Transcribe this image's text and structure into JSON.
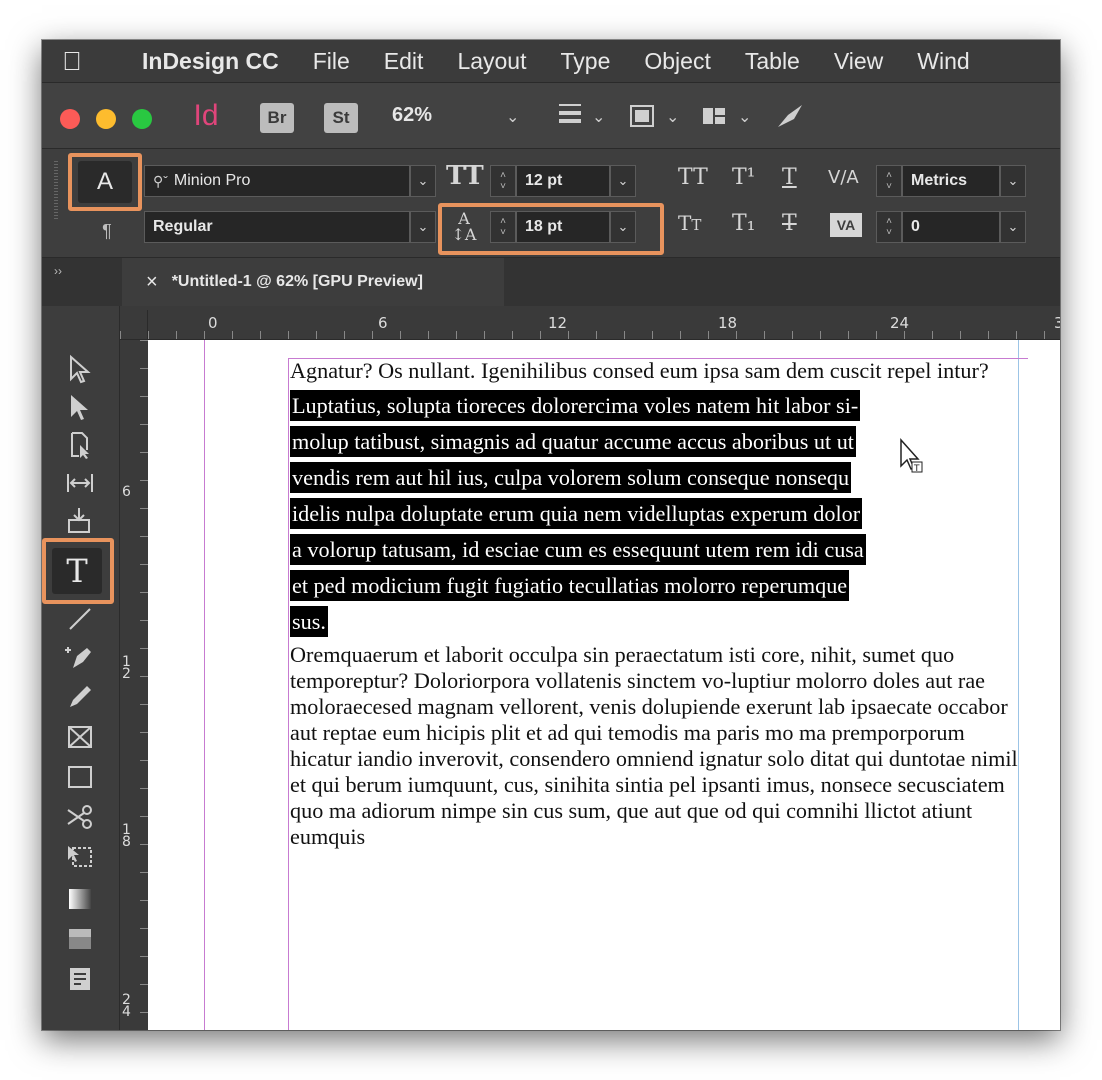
{
  "menubar": {
    "app_name": "InDesign CC",
    "items": [
      "File",
      "Edit",
      "Layout",
      "Type",
      "Object",
      "Table",
      "View",
      "Wind"
    ]
  },
  "appbar": {
    "id_badge": "Id",
    "br_badge": "Br",
    "st_badge": "St",
    "zoom": "62%"
  },
  "control_panel": {
    "font_family": "Minion Pro",
    "font_style": "Regular",
    "font_size": "12 pt",
    "leading": "18 pt",
    "kerning": "Metrics",
    "tracking": "0",
    "char_mode_label": "A",
    "para_mode_label": "¶"
  },
  "tab": {
    "close": "×",
    "title": "*Untitled-1 @ 62% [GPU Preview]"
  },
  "ruler": {
    "h_labels": [
      "0",
      "6",
      "12",
      "18",
      "24",
      "3"
    ],
    "v_labels": [
      "6",
      "1\n2",
      "1\n8",
      "2\n4"
    ]
  },
  "story": {
    "para1": "Agnatur? Os nullant. Igenihilibus consed eum ipsa sam dem cuscit repel intur?",
    "selected_lines": [
      "Luptatius, solupta tioreces dolorercima voles natem hit labor si-",
      "molup tatibust, simagnis ad quatur accume accus aboribus ut ut",
      "vendis rem aut hil ius, culpa volorem solum conseque nonsequ",
      "idelis nulpa doluptate erum quia nem videlluptas experum dolor",
      "a volorup tatusam, id esciae cum es essequunt utem rem idi cusa",
      "et ped modicium fugit fugiatio tecullatias molorro reperumque",
      "sus."
    ],
    "para3": "Oremquaerum et laborit occulpa sin peraectatum isti core, nihit, sumet quo temporeptur? Doloriorpora vollatenis sinctem vo-luptiur molorro doles aut rae moloraecesed magnam vellorent, venis dolupiende exerunt lab ipsaecate occabor aut reptae eum hicipis plit et ad qui temodis ma paris mo ma premporporum hicatur iandio inverovit, consendero omniend ignatur solo ditat qui duntotae nimil et qui berum iumquunt, cus, sinihita sintia pel ipsanti imus, nonsece secusciatem quo ma adiorum nimpe sin cus sum, que aut que od qui comnihi llictot atiunt eumquis"
  },
  "highlight_color": "#e8935d",
  "icons": [
    "apple-icon",
    "search-icon",
    "font-size-icon",
    "leading-icon",
    "type-tool-icon",
    "selection-tool-icon"
  ]
}
